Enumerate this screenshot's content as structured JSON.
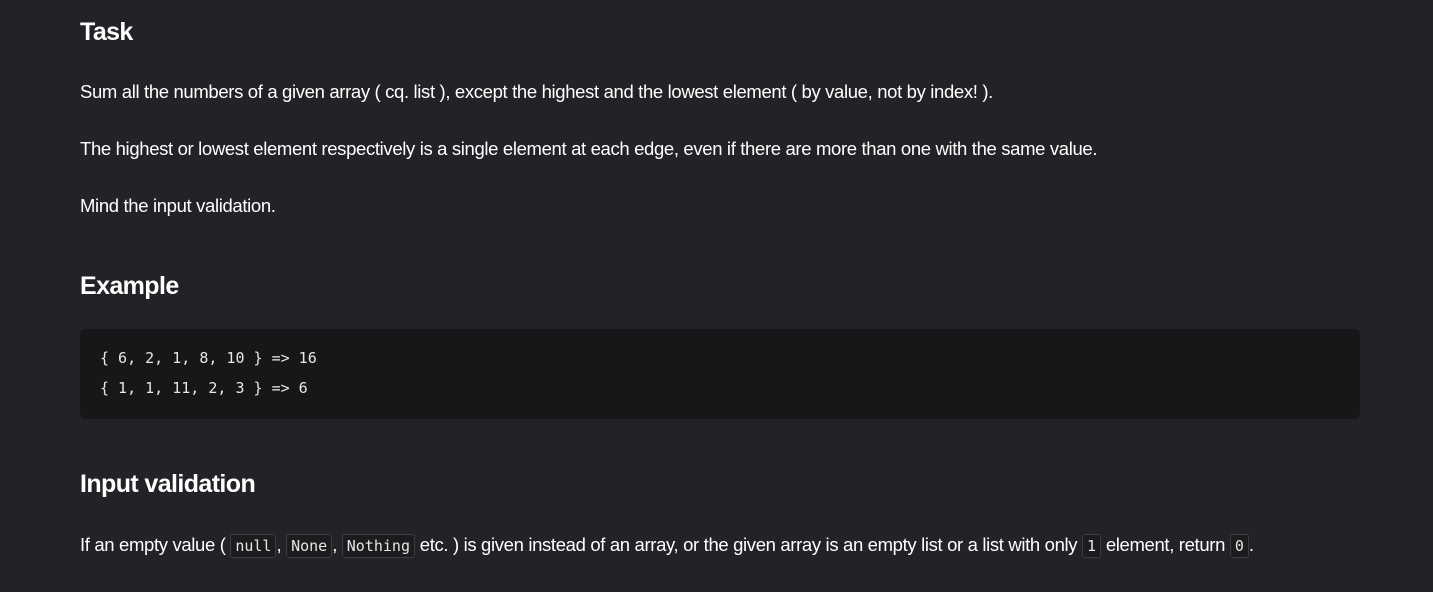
{
  "task": {
    "heading": "Task",
    "paragraph1": "Sum all the numbers of a given array ( cq. list ), except the highest and the lowest element ( by value, not by index! ).",
    "paragraph2": "The highest or lowest element respectively is a single element at each edge, even if there are more than one with the same value.",
    "paragraph3": "Mind the input validation."
  },
  "example": {
    "heading": "Example",
    "code_lines": [
      "{ 6, 2, 1, 8, 10 } => 16",
      "{ 1, 1, 11, 2, 3 } => 6"
    ]
  },
  "validation": {
    "heading": "Input validation",
    "text1": "If an empty value (",
    "code_null": "null",
    "sep1": ",",
    "code_none": "None",
    "sep2": ",",
    "code_nothing": "Nothing",
    "text2": "etc. ) is given instead of an array, or the given array is an empty list or a list with only",
    "code_one": "1",
    "text3": "element, return",
    "code_zero": "0",
    "text4": "."
  }
}
